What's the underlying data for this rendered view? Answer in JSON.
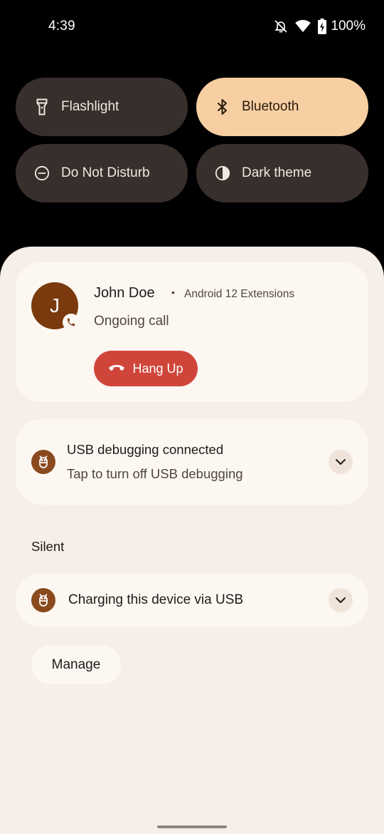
{
  "status_bar": {
    "time": "4:39",
    "battery_percent": "100%",
    "icons": [
      "notifications-off-icon",
      "wifi-icon",
      "battery-charging-icon"
    ]
  },
  "quick_settings": {
    "tiles": [
      {
        "label": "Flashlight",
        "icon": "flashlight-icon",
        "active": false
      },
      {
        "label": "Bluetooth",
        "icon": "bluetooth-icon",
        "active": true
      },
      {
        "label": "Do Not Disturb",
        "icon": "do-not-disturb-icon",
        "active": false
      },
      {
        "label": "Dark theme",
        "icon": "dark-theme-icon",
        "active": false
      }
    ]
  },
  "notifications": {
    "call": {
      "avatar_initial": "J",
      "caller": "John Doe",
      "separator": "•",
      "app": "Android 12 Extensions",
      "status": "Ongoing call",
      "hangup_label": "Hang Up"
    },
    "usb_debugging": {
      "title": "USB debugging connected",
      "subtitle": "Tap to turn off USB debugging"
    },
    "silent_section": {
      "header": "Silent"
    },
    "charging": {
      "title": "Charging this device via USB"
    },
    "manage_label": "Manage"
  },
  "colors": {
    "tile_inactive": "#362f2c",
    "tile_active": "#f7cfa3",
    "shade_bg": "#f6eee8",
    "card_bg": "#fdf7f2",
    "hangup": "#d0453a",
    "avatar": "#7a3a0d"
  }
}
